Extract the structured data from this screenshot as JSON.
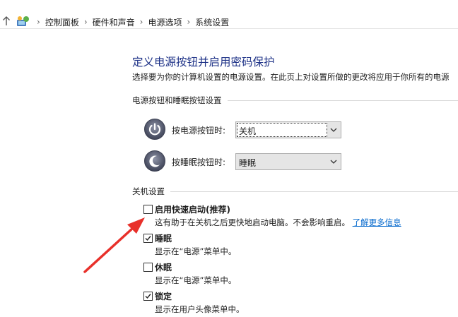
{
  "breadcrumb": {
    "items": [
      "控制面板",
      "硬件和声音",
      "电源选项",
      "系统设置"
    ],
    "separator": "›"
  },
  "page": {
    "title": "定义电源按钮并启用密码保护",
    "description": "选择要为你的计算机设置的电源设置。在此页上对设置所做的更改将应用于你所有的电源"
  },
  "power_buttons": {
    "header": "电源按钮和睡眠按钮设置",
    "rows": [
      {
        "label": "按电源按钮时:",
        "value": "关机"
      },
      {
        "label": "按睡眠按钮时:",
        "value": "睡眠"
      }
    ]
  },
  "shutdown": {
    "header": "关机设置",
    "options": [
      {
        "label": "启用快速启动(推荐)",
        "checked": false,
        "desc": "这有助于在关机之后更快地启动电脑。不会影响重启。",
        "link": "了解更多信息"
      },
      {
        "label": "睡眠",
        "checked": true,
        "desc": "显示在“电源”菜单中。"
      },
      {
        "label": "休眠",
        "checked": false,
        "desc": "显示在“电源”菜单中。"
      },
      {
        "label": "锁定",
        "checked": true,
        "desc": "显示在用户头像菜单中。"
      }
    ]
  },
  "colors": {
    "title": "#1e3287",
    "link": "#0066cc",
    "annotation_arrow": "#e8302a"
  }
}
